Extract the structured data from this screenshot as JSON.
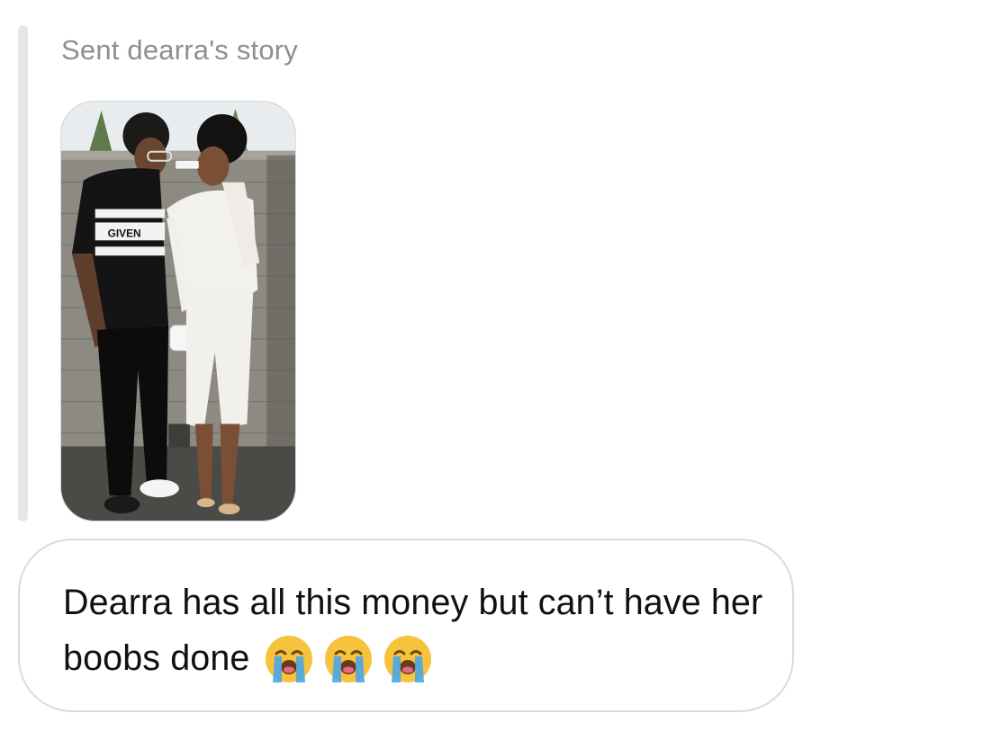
{
  "story": {
    "label": "Sent dearra's story",
    "shirt_text": "GIVEN"
  },
  "message": {
    "text": "Dearra has all this money but can’t have her boobs done",
    "emojis": [
      "loudly-crying-face-icon",
      "loudly-crying-face-icon",
      "loudly-crying-face-icon"
    ]
  },
  "colors": {
    "bubble_border": "#dbdbdb",
    "label_gray": "#8e8e8e",
    "emoji_yellow": "#f7c23c",
    "tears_blue": "#4aa6e8"
  }
}
